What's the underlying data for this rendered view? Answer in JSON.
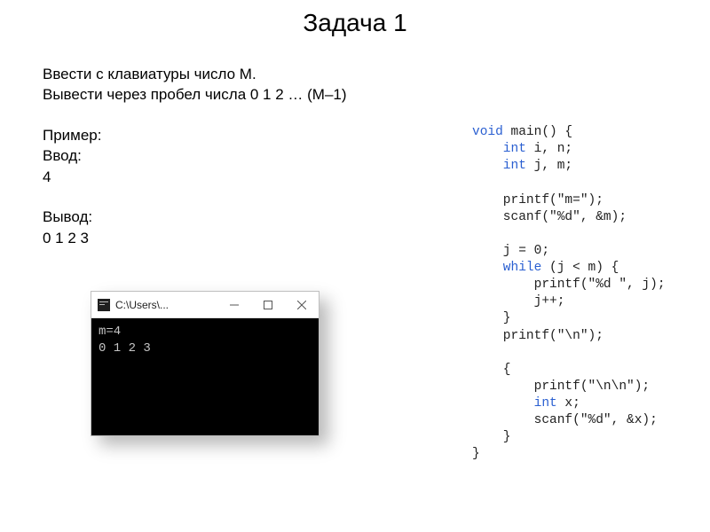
{
  "title": "Задача 1",
  "problem": {
    "line1": "Ввести с клавиатуры число M.",
    "line2": "Вывести через пробел числа 0 1 2 … (М–1)",
    "example_label": "Пример:",
    "input_label": "Ввод:",
    "input_value": " 4",
    "output_label": "Вывод:",
    "output_value": "0 1 2 3"
  },
  "console": {
    "window_title": "C:\\Users\\...",
    "lines": "m=4\n0 1 2 3"
  },
  "code": {
    "l01a": "void",
    "l01b": " main() {",
    "l02a": "    int",
    "l02b": " i, n;",
    "l03a": "    int",
    "l03b": " j, m;",
    "blank": "",
    "l05": "    printf(\"m=\");",
    "l06": "    scanf(\"%d\", &m);",
    "l08": "    j = 0;",
    "l09a": "    while",
    "l09b": " (j < m) {",
    "l10": "        printf(\"%d \", j);",
    "l11": "        j++;",
    "l12": "    }",
    "l13": "    printf(\"\\n\");",
    "l15": "    {",
    "l16": "        printf(\"\\n\\n\");",
    "l17a": "        int",
    "l17b": " x;",
    "l18": "        scanf(\"%d\", &x);",
    "l19": "    }",
    "l20": "}"
  }
}
